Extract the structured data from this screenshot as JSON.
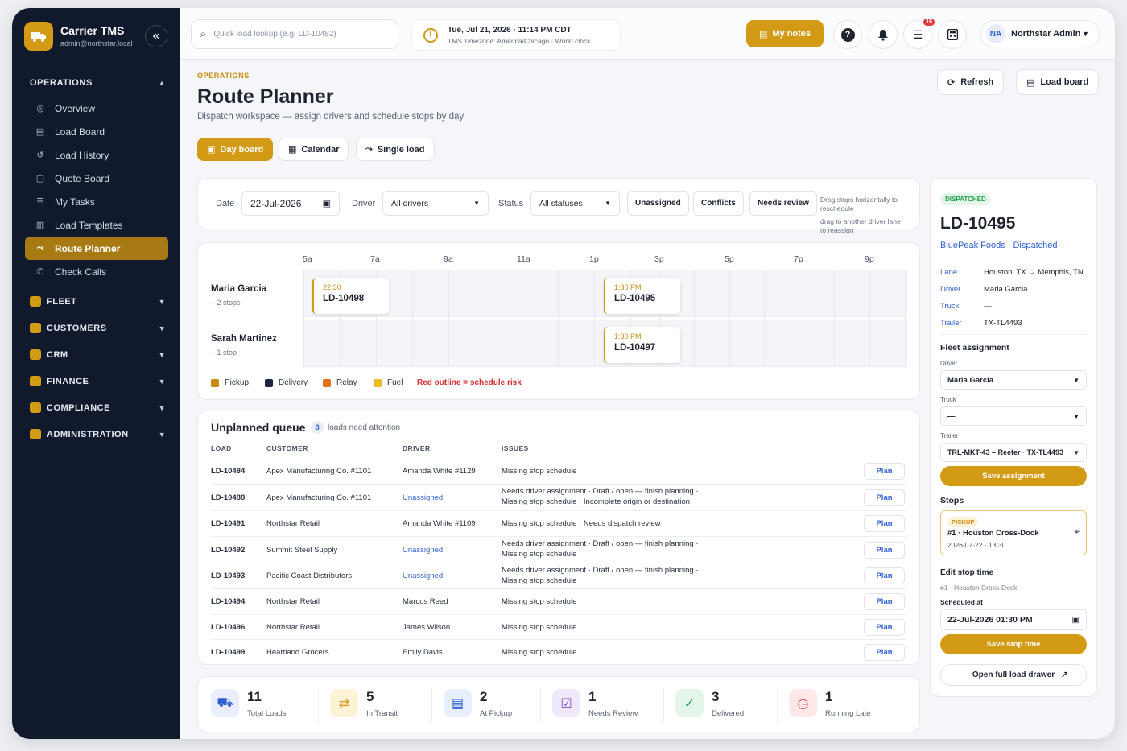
{
  "app": {
    "name": "Carrier TMS",
    "email": "admin@northstar.local"
  },
  "sidebar": {
    "operations_label": "OPERATIONS",
    "items": [
      {
        "label": "Overview",
        "icon": "dashboard-icon"
      },
      {
        "label": "Load Board",
        "icon": "clipboard-icon"
      },
      {
        "label": "Load History",
        "icon": "history-icon"
      },
      {
        "label": "Quote Board",
        "icon": "document-icon"
      },
      {
        "label": "My Tasks",
        "icon": "list-icon"
      },
      {
        "label": "Load Templates",
        "icon": "template-icon"
      },
      {
        "label": "Route Planner",
        "icon": "route-icon",
        "active": true
      },
      {
        "label": "Check Calls",
        "icon": "phone-icon"
      }
    ],
    "groups": [
      {
        "label": "FLEET",
        "icon": "truck-icon"
      },
      {
        "label": "CUSTOMERS",
        "icon": "customers-icon"
      },
      {
        "label": "CRM",
        "icon": "crm-icon"
      },
      {
        "label": "FINANCE",
        "icon": "finance-icon"
      },
      {
        "label": "COMPLIANCE",
        "icon": "shield-icon"
      },
      {
        "label": "ADMINISTRATION",
        "icon": "gear-icon"
      }
    ]
  },
  "topbar": {
    "search_placeholder": "Quick load lookup (e.g. LD-10482)",
    "clock_main": "Tue, Jul 21, 2026 · 11:14 PM CDT",
    "clock_sub": "TMS Timezone: America/Chicago · World clock",
    "notes_label": "My notes",
    "notifications_badge": "16",
    "user_initials": "NA",
    "user_name": "Northstar Admin"
  },
  "page": {
    "eyebrow": "OPERATIONS",
    "title": "Route Planner",
    "subtitle": "Dispatch workspace — assign drivers and schedule stops by day",
    "refresh_label": "Refresh",
    "loadboard_label": "Load board",
    "tabs": [
      "Day board",
      "Calendar",
      "Single load"
    ]
  },
  "filters": {
    "date_label": "Date",
    "date_value": "22-Jul-2026",
    "driver_label": "Driver",
    "driver_value": "All drivers",
    "status_label": "Status",
    "status_value": "All statuses",
    "chips": [
      "Unassigned",
      "Conflicts",
      "Needs review"
    ],
    "hint1": "Drag stops horizontally to reschedule",
    "hint2": "drag to another driver lane to reassign"
  },
  "timeline": {
    "hours": [
      "5a",
      "7a",
      "9a",
      "11a",
      "1p",
      "3p",
      "5p",
      "7p",
      "9p"
    ],
    "drivers": [
      {
        "name": "Maria Garcia",
        "stops": "– 2 stops",
        "loads": [
          {
            "time": "22:30",
            "id": "LD-10498"
          },
          {
            "time": "1:30 PM",
            "id": "LD-10495"
          }
        ]
      },
      {
        "name": "Sarah Martinez",
        "stops": "– 1 stop",
        "loads": [
          {
            "time": "1:30 PM",
            "id": "LD-10497"
          }
        ]
      }
    ],
    "legend": [
      {
        "label": "Pickup",
        "color": "#c98b0e"
      },
      {
        "label": "Delivery",
        "color": "#1b2540"
      },
      {
        "label": "Relay",
        "color": "#e2711d"
      },
      {
        "label": "Fuel",
        "color": "#f0b82a"
      }
    ],
    "risk_note": "Red outline = schedule risk"
  },
  "queue": {
    "title": "Unplanned queue",
    "count": "8",
    "subtitle": "loads need attention",
    "headers": [
      "LOAD",
      "CUSTOMER",
      "DRIVER",
      "ISSUES"
    ],
    "plan_label": "Plan",
    "rows": [
      {
        "load": "LD-10484",
        "customer": "Apex Manufacturing Co. #1101",
        "driver": "Amanda White #1129",
        "unassigned": false,
        "issue1": "Missing stop schedule",
        "issue2": ""
      },
      {
        "load": "LD-10488",
        "customer": "Apex Manufacturing Co. #1101",
        "driver": "Unassigned",
        "unassigned": true,
        "issue1": "Needs driver assignment · Draft / open — finish planning ·",
        "issue2": "Missing stop schedule · Incomplete origin or destination"
      },
      {
        "load": "LD-10491",
        "customer": "Northstar Retail",
        "driver": "Amanda White #1109",
        "unassigned": false,
        "issue1": "Missing stop schedule · Needs dispatch review",
        "issue2": ""
      },
      {
        "load": "LD-10492",
        "customer": "Summit Steel Supply",
        "driver": "Unassigned",
        "unassigned": true,
        "issue1": "Needs driver assignment · Draft / open — finish planning ·",
        "issue2": "Missing stop schedule"
      },
      {
        "load": "LD-10493",
        "customer": "Pacific Coast Distributors",
        "driver": "Unassigned",
        "unassigned": true,
        "issue1": "Needs driver assignment · Draft / open — finish planning ·",
        "issue2": "Missing stop schedule"
      },
      {
        "load": "LD-10494",
        "customer": "Northstar Retail",
        "driver": "Marcus Reed",
        "unassigned": false,
        "issue1": "Missing stop schedule",
        "issue2": ""
      },
      {
        "load": "LD-10496",
        "customer": "Northstar Retail",
        "driver": "James Wilson",
        "unassigned": false,
        "issue1": "Missing stop schedule",
        "issue2": ""
      },
      {
        "load": "LD-10499",
        "customer": "Heartland Grocers",
        "driver": "Emily Davis",
        "unassigned": false,
        "issue1": "Missing stop schedule",
        "issue2": ""
      }
    ]
  },
  "kpis": [
    {
      "value": "11",
      "label": "Total Loads",
      "icon": "truck-icon",
      "bg": "#e8eefb",
      "fg": "#2f5fd0"
    },
    {
      "value": "5",
      "label": "In Transit",
      "icon": "transit-icon",
      "bg": "#fdf1d8",
      "fg": "#d39a16"
    },
    {
      "value": "2",
      "label": "At Pickup",
      "icon": "clipboard-icon",
      "bg": "#e8eefb",
      "fg": "#2f5fd0"
    },
    {
      "value": "1",
      "label": "Needs Review",
      "icon": "review-icon",
      "bg": "#efe9fb",
      "fg": "#7b4fd0"
    },
    {
      "value": "3",
      "label": "Delivered",
      "icon": "check-circle-icon",
      "bg": "#e4f6ea",
      "fg": "#22a04b"
    },
    {
      "value": "1",
      "label": "Running Late",
      "icon": "clock-alert-icon",
      "bg": "#fde7e7",
      "fg": "#d93a3a"
    }
  ],
  "detail": {
    "status": "DISPATCHED",
    "load_id": "LD-10495",
    "subtitle": "BluePeak Foods · Dispatched",
    "lane_label": "Lane",
    "lane_value": "Houston, TX → Memphis, TN",
    "driver_label": "Driver",
    "driver_value": "Maria Garcia",
    "truck_label": "Truck",
    "truck_value": "—",
    "trailer_label": "Trailer",
    "trailer_value": "TX-TL4493",
    "fleet_title": "Fleet assignment",
    "f_driver_label": "Driver",
    "f_driver_value": "Maria Garcia",
    "f_truck_label": "Truck",
    "f_truck_value": "—",
    "f_trailer_label": "Trailer",
    "f_trailer_value": "TRL-MKT-43 – Reefer · TX-TL4493",
    "save_assignment": "Save assignment",
    "stops_title": "Stops",
    "stop_type": "PICKUP",
    "stop_name": "#1 · Houston Cross-Dock",
    "stop_time": "2026-07-22 · 13:30",
    "edit_title": "Edit stop time",
    "edit_sub": "#1 · Houston Cross-Dock",
    "scheduled_label": "Scheduled at",
    "scheduled_value": "22-Jul-2026 01:30 PM",
    "save_stop": "Save stop time",
    "open_drawer": "Open full load drawer"
  }
}
